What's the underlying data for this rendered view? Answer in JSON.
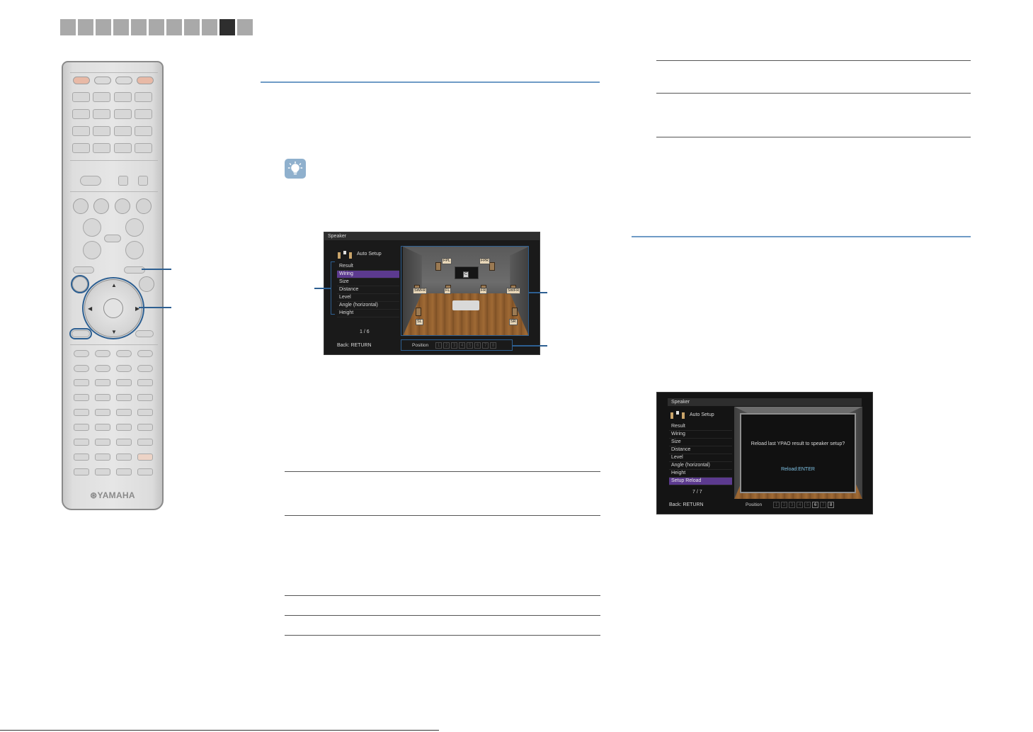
{
  "tabs": {
    "count": 11,
    "active_index": 9
  },
  "remote": {
    "brand": "⊛YAMAHA"
  },
  "screen1": {
    "title": "Speaker",
    "heading": "Auto Setup",
    "menu": [
      "Result",
      "Wiring",
      "Size",
      "Distance",
      "Level",
      "Angle (horizontal)",
      "Height"
    ],
    "selected_index": 1,
    "page": "1 / 6",
    "back": "Back: RETURN",
    "position_label": "Position",
    "positions": [
      "1",
      "2",
      "3",
      "4",
      "5",
      "6",
      "7",
      "8"
    ],
    "speakers": [
      "FPL",
      "FPR",
      "C",
      "SWFR",
      "FL",
      "FR",
      "SWFR",
      "SL",
      "SR"
    ]
  },
  "screen2": {
    "title": "Speaker",
    "heading": "Auto Setup",
    "menu": [
      "Result",
      "Wiring",
      "Size",
      "Distance",
      "Level",
      "Angle (horizontal)",
      "Height",
      "Setup Reload"
    ],
    "selected_index": 7,
    "page": "7 / 7",
    "back": "Back: RETURN",
    "position_label": "Position",
    "positions": [
      "1",
      "2",
      "3",
      "4",
      "5",
      "6",
      "7",
      "8"
    ],
    "dialog_message": "Reload last YPAO result to speaker setup?",
    "dialog_action": "Reload:ENTER"
  },
  "colors": {
    "accent": "#2d5f91",
    "rule_blue": "#6f9bc6",
    "tab": "#a9a9a9",
    "tab_active": "#2e2e2e",
    "menu_highlight": "#5c3a8f"
  }
}
